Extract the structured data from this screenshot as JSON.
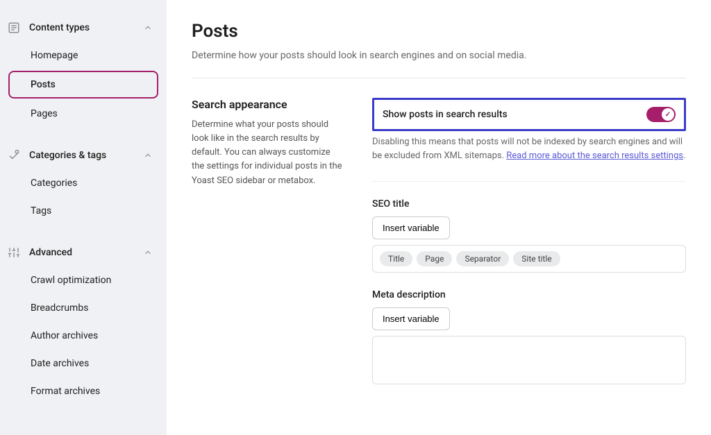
{
  "sidebar": {
    "sections": [
      {
        "title": "Content types",
        "items": [
          {
            "label": "Homepage"
          },
          {
            "label": "Posts"
          },
          {
            "label": "Pages"
          }
        ]
      },
      {
        "title": "Categories & tags",
        "items": [
          {
            "label": "Categories"
          },
          {
            "label": "Tags"
          }
        ]
      },
      {
        "title": "Advanced",
        "items": [
          {
            "label": "Crawl optimization"
          },
          {
            "label": "Breadcrumbs"
          },
          {
            "label": "Author archives"
          },
          {
            "label": "Date archives"
          },
          {
            "label": "Format archives"
          }
        ]
      }
    ]
  },
  "page": {
    "title": "Posts",
    "description": "Determine how your posts should look in search engines and on social media."
  },
  "search_appearance": {
    "heading": "Search appearance",
    "description": "Determine what your posts should look like in the search results by default. You can always customize the settings for individual posts in the Yoast SEO sidebar or metabox.",
    "toggle_label": "Show posts in search results",
    "help_text_prefix": "Disabling this means that posts will not be indexed by search engines and will be excluded from XML sitemaps. ",
    "help_link_text": "Read more about the search results settings",
    "help_text_suffix": "."
  },
  "seo_title": {
    "label": "SEO title",
    "insert_button": "Insert variable",
    "chips": [
      "Title",
      "Page",
      "Separator",
      "Site title"
    ]
  },
  "meta_description": {
    "label": "Meta description",
    "insert_button": "Insert variable"
  }
}
